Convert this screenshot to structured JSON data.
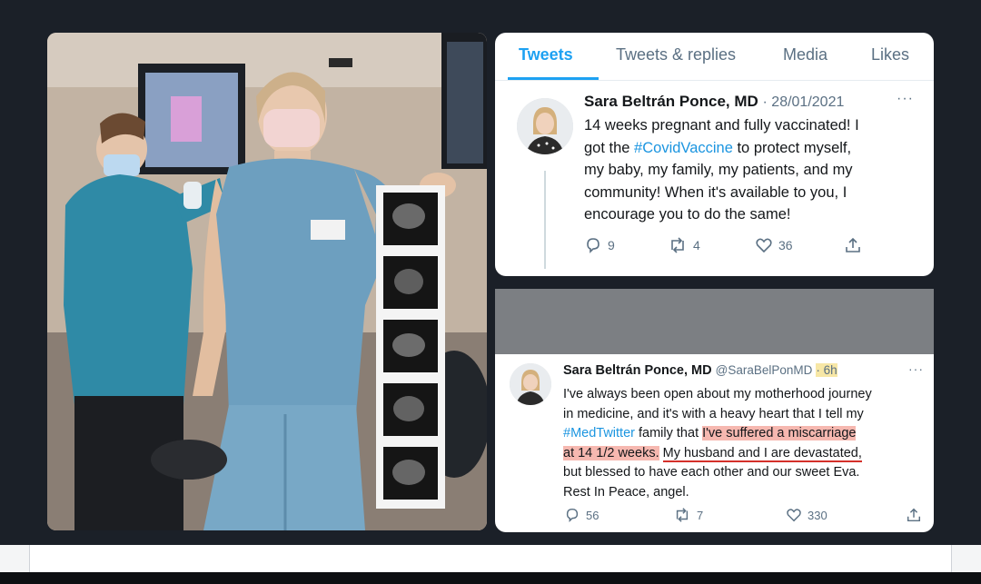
{
  "tabs": [
    "Tweets",
    "Tweets & replies",
    "Media",
    "Likes"
  ],
  "tweet1": {
    "name": "Sara Beltrán Ponce, MD",
    "date": "· 28/01/2021",
    "more": "···",
    "lines": [
      "14 weeks pregnant and fully vaccinated! I",
      "got the ",
      "#CovidVaccine",
      " to protect myself,",
      "my baby, my family, my patients, and my",
      "community! When it's available to you, I",
      "encourage you to do the same!"
    ],
    "replies": "9",
    "retweets": "4",
    "likes": "36"
  },
  "tweet2": {
    "name": "Sara Beltrán Ponce, MD",
    "handle": "@SaraBelPonMD",
    "time": "· 6h",
    "more": "···",
    "line1": "I've always been open about my motherhood journey",
    "line2": "in medicine, and it's with a heavy heart that I tell my",
    "line3_tag": "#MedTwitter",
    "line3_mid": " family that ",
    "line3_hl": "I've suffered a miscarriage",
    "line4_hl": "at 14 1/2 weeks.",
    "line4_ul": "My husband and I are devastated,",
    "line5": "but blessed to have each other and our sweet Eva.",
    "line6": "Rest In Peace, angel.",
    "replies": "56",
    "retweets": "7",
    "likes": "330"
  },
  "icons": [
    "reply-icon",
    "retweet-icon",
    "like-icon",
    "share-icon",
    "more-icon"
  ],
  "colors": {
    "accent": "#1da1f2",
    "hashtag": "#1b95e0",
    "highlight": "#f6b8b0",
    "time_highlight": "#f7e7a6"
  }
}
